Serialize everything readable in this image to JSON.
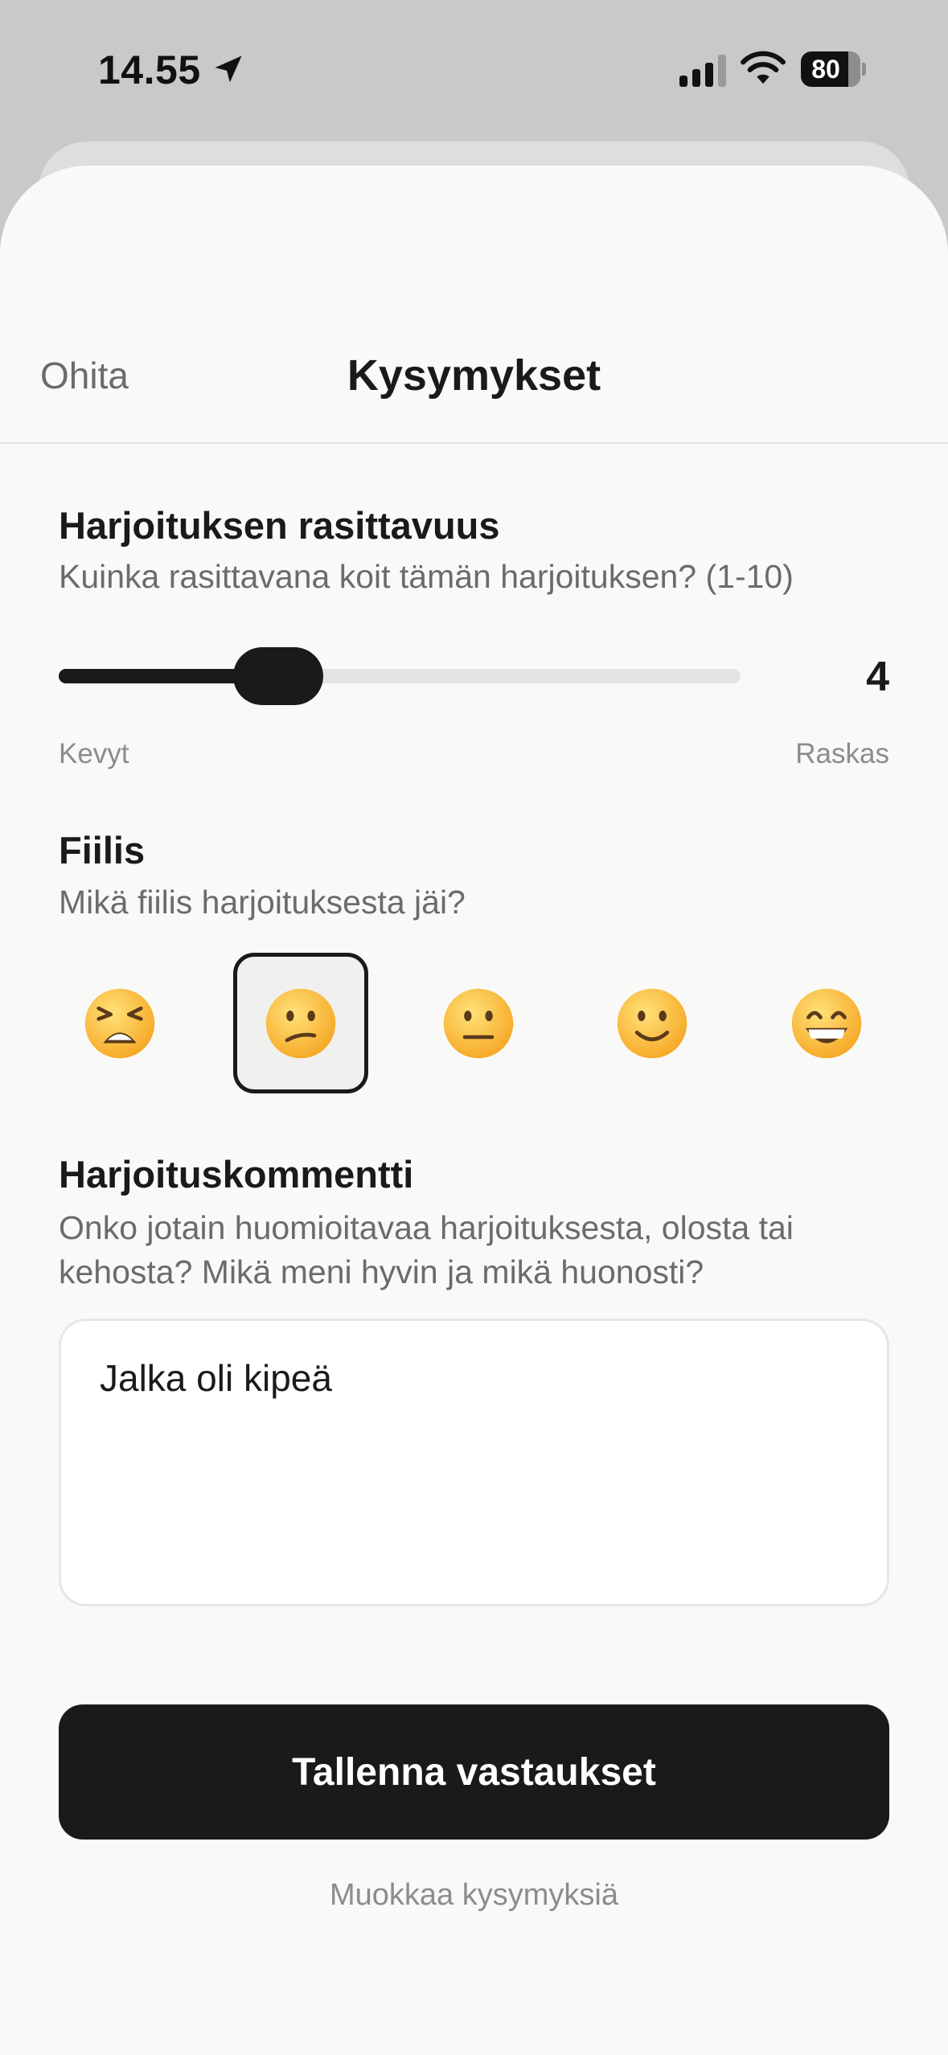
{
  "status_bar": {
    "time": "14.55",
    "battery_level": "80"
  },
  "header": {
    "skip_label": "Ohita",
    "title": "Kysymykset"
  },
  "effort": {
    "title": "Harjoituksen rasittavuus",
    "description": "Kuinka rasittavana koit tämän harjoituksen? (1-10)",
    "value": 4,
    "value_text": "4",
    "min": 1,
    "max": 10,
    "min_label": "Kevyt",
    "max_label": "Raskas"
  },
  "mood": {
    "title": "Fiilis",
    "description": "Mikä fiilis harjoituksesta jäi?",
    "options": [
      {
        "icon": "tired-face-icon"
      },
      {
        "icon": "confused-face-icon",
        "selected": true
      },
      {
        "icon": "neutral-face-icon"
      },
      {
        "icon": "slightly-smiling-face-icon"
      },
      {
        "icon": "grinning-face-icon"
      }
    ],
    "selected_index": 1
  },
  "comment": {
    "title": "Harjoituskommentti",
    "description": "Onko jotain huomioitavaa harjoituksesta, olosta tai kehosta? Mikä meni hyvin ja mikä huonosti?",
    "value": "Jalka oli kipeä"
  },
  "actions": {
    "save_label": "Tallenna vastaukset",
    "edit_label": "Muokkaa kysymyksiä"
  },
  "colors": {
    "primary": "#1c1a19",
    "background": "#f9f9f8",
    "muted_text": "#6b6b6b",
    "emoji_yellow": "#fbc02d"
  }
}
